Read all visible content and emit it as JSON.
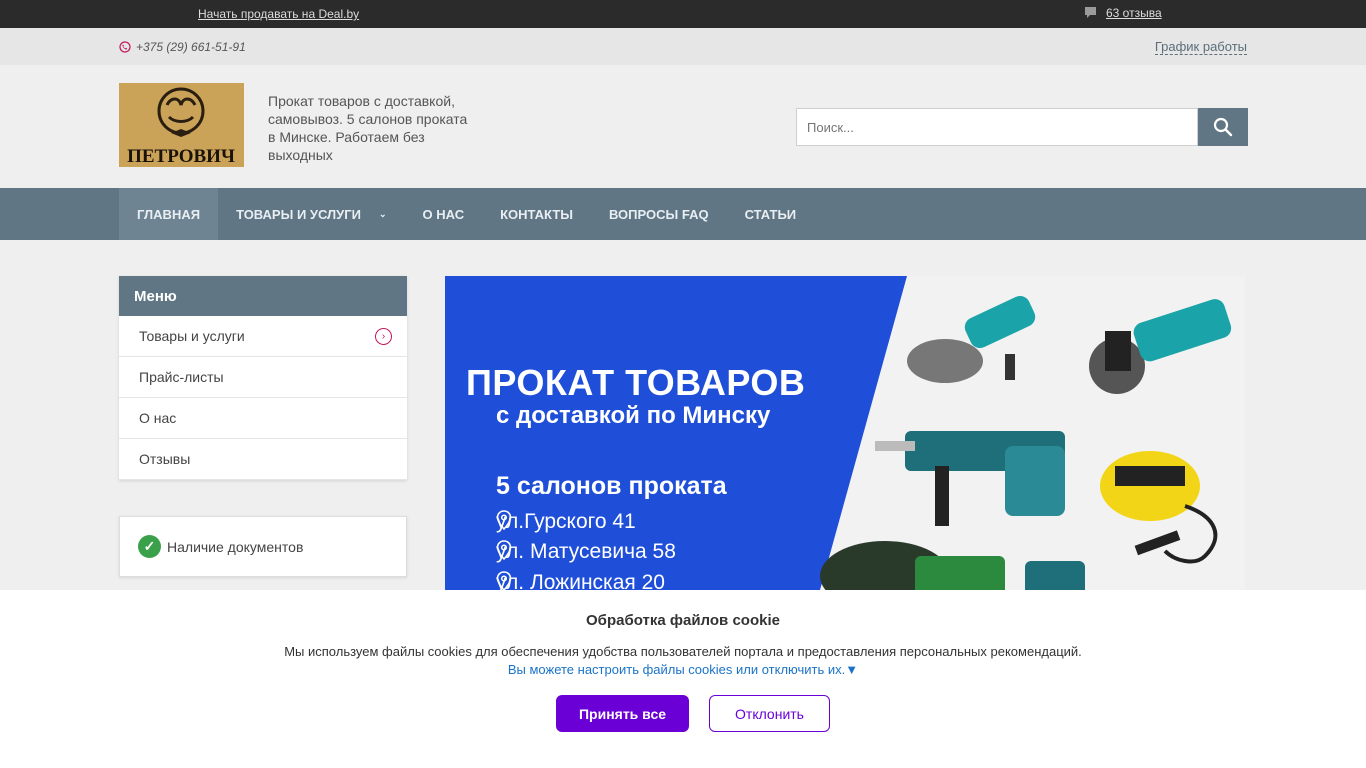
{
  "topbar": {
    "sell_link": "Начать продавать на Deal.by",
    "reviews_link": "63 отзыва"
  },
  "contacts": {
    "phone": "+375 (29) 661-51-91",
    "schedule_link": "График работы"
  },
  "header": {
    "logo_text": "ПЕТРОВИЧ",
    "tagline": "Прокат товаров с доставкой, самовывоз. 5 салонов проката в Минске. Работаем без выходных",
    "search_placeholder": "Поиск..."
  },
  "nav": {
    "items": [
      "Главная",
      "Товары и услуги",
      "О нас",
      "Контакты",
      "Вопросы FAQ",
      "Статьи"
    ]
  },
  "menu": {
    "title": "Меню",
    "items": [
      "Товары и услуги",
      "Прайс-листы",
      "О нас",
      "Отзывы"
    ]
  },
  "docs": {
    "label": "Наличие документов"
  },
  "banner": {
    "title": "ПРОКАТ ТОВАРОВ",
    "subtitle": "с доставкой по Минску",
    "salons": "5 салонов проката",
    "addresses": [
      "ул.Гурского 41",
      "ул. Матусевича 58",
      "ул. Ложинская 20"
    ],
    "brand_color": "#1f4fd8"
  },
  "cookie": {
    "title": "Обработка файлов cookie",
    "text": "Мы используем файлы cookies для обеспечения удобства пользователей портала и предоставления персональных рекомендаций.",
    "link": "Вы можете настроить файлы cookies или отключить их.▼",
    "accept_label": "Принять все",
    "decline_label": "Отклонить",
    "accent_color": "#6a00d6"
  }
}
